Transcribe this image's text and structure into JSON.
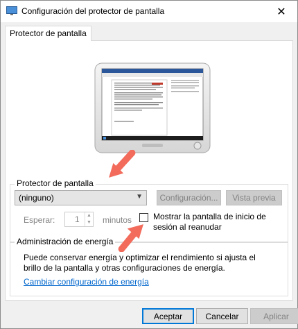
{
  "window": {
    "title": "Configuración del protector de pantalla",
    "close_glyph": "✕"
  },
  "tab": {
    "label": "Protector de pantalla"
  },
  "screensaver": {
    "group_label": "Protector de pantalla",
    "selected": "(ninguno)",
    "config_button": "Configuración...",
    "preview_button": "Vista previa",
    "wait_label": "Esperar:",
    "wait_value": "1",
    "minutes_label": "minutos",
    "resume_checkbox_label": "Mostrar la pantalla de inicio de sesión al reanudar",
    "resume_checked": false
  },
  "power": {
    "group_label": "Administración de energía",
    "description": "Puede conservar energía y optimizar el rendimiento si ajusta el brillo de la pantalla y otras configuraciones de energía.",
    "link": "Cambiar configuración de energía"
  },
  "footer": {
    "ok": "Aceptar",
    "cancel": "Cancelar",
    "apply": "Aplicar"
  },
  "colors": {
    "annotation_arrow": "#f26b5b",
    "link": "#0066cc",
    "accent": "#0078d7"
  }
}
